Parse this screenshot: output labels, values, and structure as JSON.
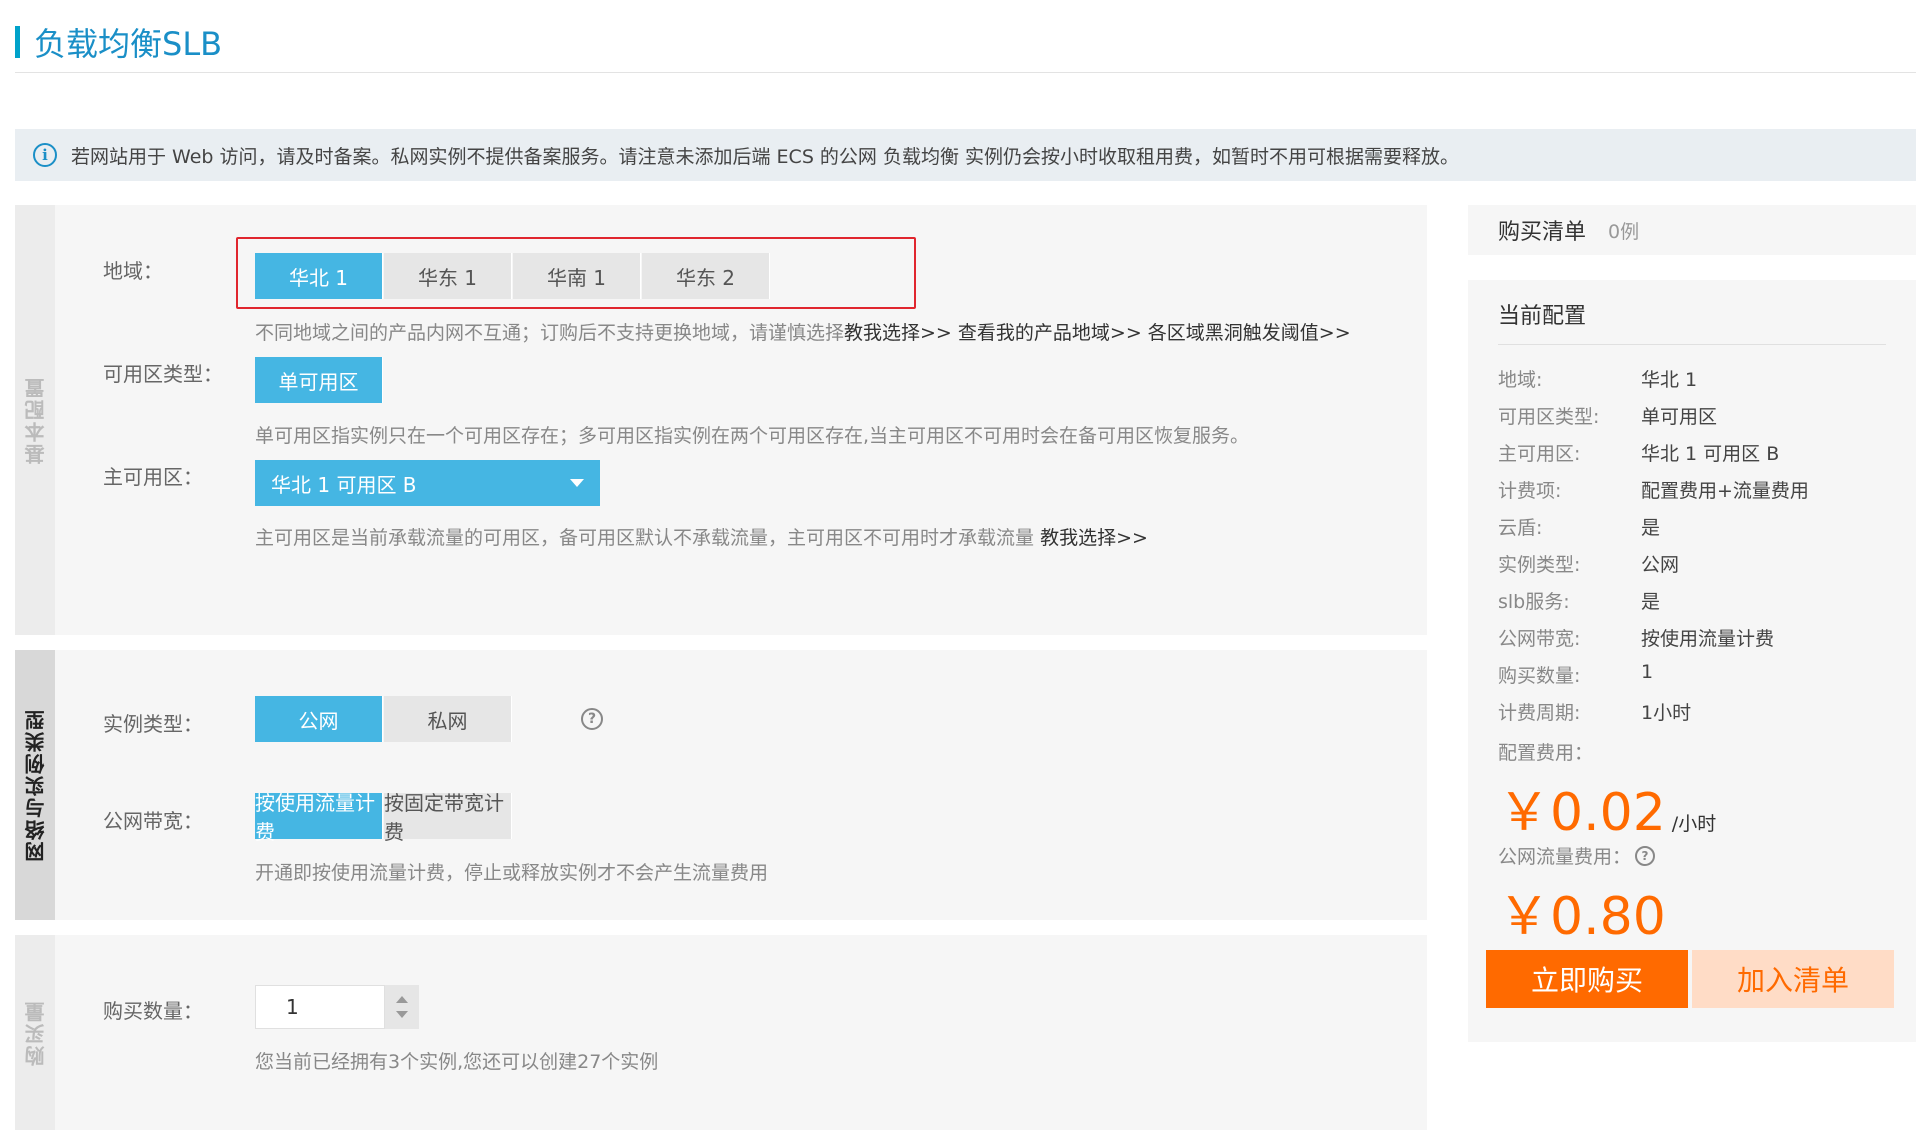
{
  "page": {
    "title": "负载均衡SLB"
  },
  "notice": {
    "icon": "info-icon",
    "text": "若网站用于 Web 访问，请及时备案。私网实例不提供备案服务。请注意未添加后端 ECS 的公网 负载均衡 实例仍会按小时收取租用费，如暂时不用可根据需要释放。"
  },
  "basic": {
    "side_label": "基本配置",
    "region": {
      "label": "地域：",
      "options": [
        "华北 1",
        "华东 1",
        "华南 1",
        "华东 2"
      ],
      "selected": "华北 1",
      "hint_text": "不同地域之间的产品内网不互通；订购后不支持更换地域，请谨慎选择",
      "links": [
        "教我选择>>",
        "查看我的产品地域>>",
        "各区域黑洞触发阈值>>"
      ]
    },
    "zone_type": {
      "label": "可用区类型：",
      "option": "单可用区",
      "hint": "单可用区指实例只在一个可用区存在；多可用区指实例在两个可用区存在,当主可用区不可用时会在备可用区恢复服务。"
    },
    "main_zone": {
      "label": "主可用区：",
      "value": "华北 1 可用区 B",
      "hint_text": "主可用区是当前承载流量的可用区，备可用区默认不承载流量，主可用区不可用时才承载流量",
      "link": "教我选择>>"
    }
  },
  "network": {
    "side_label": "网络与实例类型",
    "instance_type": {
      "label": "实例类型：",
      "options": [
        "公网",
        "私网"
      ],
      "selected": "公网",
      "help_icon": "question-icon"
    },
    "bandwidth": {
      "label": "公网带宽：",
      "options": [
        "按使用流量计费",
        "按固定带宽计费"
      ],
      "selected": "按使用流量计费",
      "hint": "开通即按使用流量计费，停止或释放实例才不会产生流量费用"
    }
  },
  "purchase": {
    "side_label": "购买量",
    "quantity": {
      "label": "购买数量：",
      "value": "1"
    },
    "hint": "您当前已经拥有3个实例,您还可以创建27个实例"
  },
  "cart": {
    "title": "购买清单",
    "count": "0例"
  },
  "current_config": {
    "title": "当前配置",
    "rows": [
      {
        "key": "地域:",
        "value": "华北 1"
      },
      {
        "key": "可用区类型:",
        "value": "单可用区"
      },
      {
        "key": "主可用区:",
        "value": "华北 1 可用区 B"
      },
      {
        "key": "计费项:",
        "value": "配置费用+流量费用"
      },
      {
        "key": "云盾:",
        "value": "是"
      },
      {
        "key": "实例类型:",
        "value": "公网"
      },
      {
        "key": "slb服务:",
        "value": "是"
      },
      {
        "key": "公网带宽:",
        "value": "按使用流量计费"
      },
      {
        "key": "购买数量:",
        "value": "1"
      },
      {
        "key": "计费周期:",
        "value": "1小时"
      }
    ],
    "config_fee_label": "配置费用：",
    "config_fee": "￥0.02",
    "config_fee_unit": "/小时",
    "traffic_fee_label": "公网流量费用：",
    "traffic_fee": "￥0.80"
  },
  "actions": {
    "buy": "立即购买",
    "add_to_cart": "加入清单"
  },
  "colors": {
    "accent": "#45b6e3",
    "orange": "#ff6a00",
    "highlight_border": "#e0262e"
  }
}
